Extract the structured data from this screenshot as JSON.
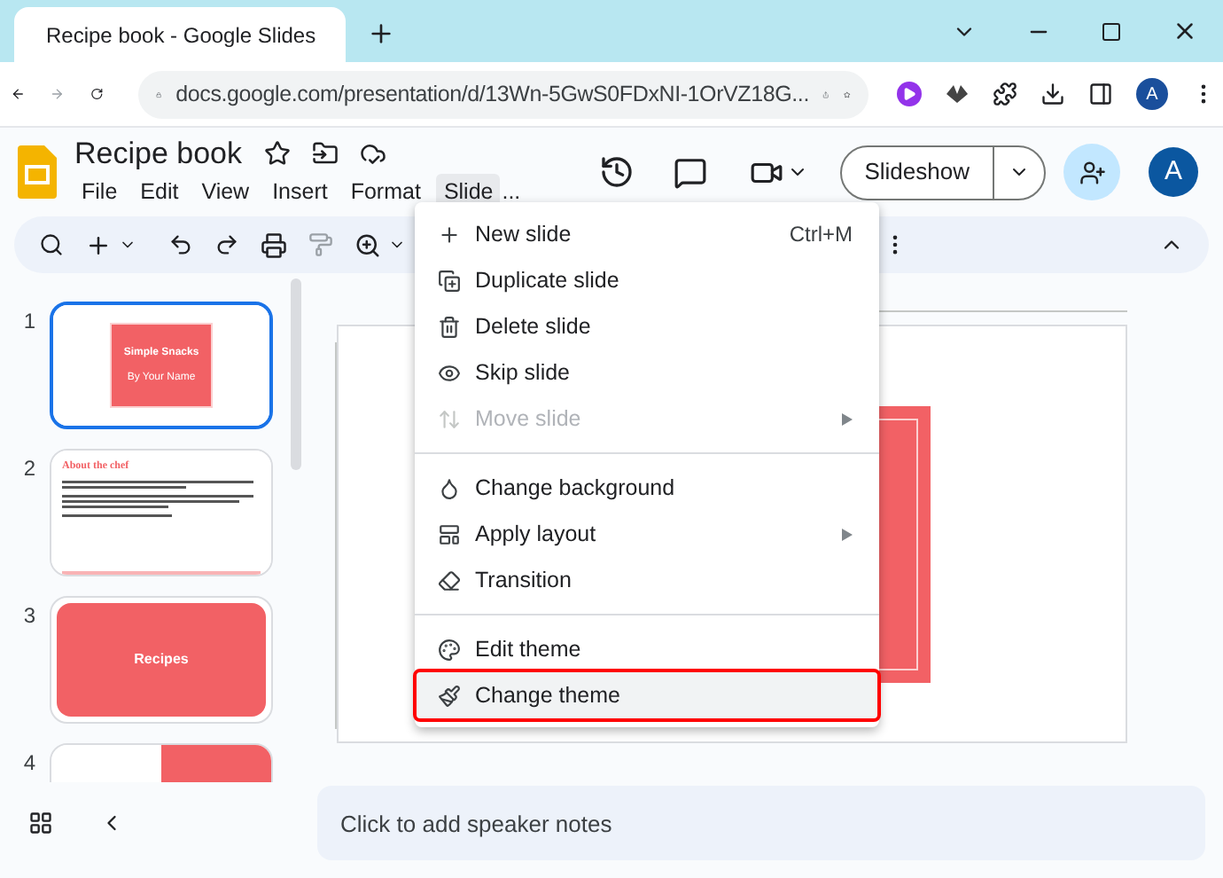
{
  "browser": {
    "tab_title": "Recipe book - Google Slides",
    "url": "docs.google.com/presentation/d/13Wn-5GwS0FDxNI-1OrVZ18G...",
    "profile": "A"
  },
  "doc": {
    "title": "Recipe book",
    "menus": [
      {
        "label": "File",
        "selected": false
      },
      {
        "label": "Edit",
        "selected": false
      },
      {
        "label": "View",
        "selected": false
      },
      {
        "label": "Insert",
        "selected": false
      },
      {
        "label": "Format",
        "selected": false
      },
      {
        "label": "Slide",
        "selected": true
      }
    ],
    "more": "...",
    "slideshow": "Slideshow",
    "avatar": "A"
  },
  "filmstrip": [
    {
      "number": "1",
      "selected": true,
      "kind": "title",
      "title": "Simple Snacks",
      "subtitle": "By Your Name"
    },
    {
      "number": "2",
      "selected": false,
      "kind": "text",
      "title": "About the chef"
    },
    {
      "number": "3",
      "selected": false,
      "kind": "section",
      "title": "Recipes"
    },
    {
      "number": "4",
      "selected": false,
      "kind": "split"
    }
  ],
  "menu": {
    "groups": [
      [
        {
          "label": "New slide",
          "shortcut": "Ctrl+M",
          "disabled": false,
          "submenu": false,
          "selected": false
        },
        {
          "label": "Duplicate slide",
          "disabled": false,
          "submenu": false,
          "selected": false
        },
        {
          "label": "Delete slide",
          "disabled": false,
          "submenu": false,
          "selected": false
        },
        {
          "label": "Skip slide",
          "disabled": false,
          "submenu": false,
          "selected": false
        },
        {
          "label": "Move slide",
          "disabled": true,
          "submenu": true,
          "selected": false
        }
      ],
      [
        {
          "label": "Change background",
          "disabled": false,
          "submenu": false,
          "selected": false
        },
        {
          "label": "Apply layout",
          "disabled": false,
          "submenu": true,
          "selected": false
        },
        {
          "label": "Transition",
          "disabled": false,
          "submenu": false,
          "selected": false
        }
      ],
      [
        {
          "label": "Edit theme",
          "disabled": false,
          "submenu": false,
          "selected": false
        },
        {
          "label": "Change theme",
          "disabled": false,
          "submenu": false,
          "selected": true
        }
      ]
    ]
  },
  "notes": {
    "placeholder": "Click to add speaker notes"
  }
}
